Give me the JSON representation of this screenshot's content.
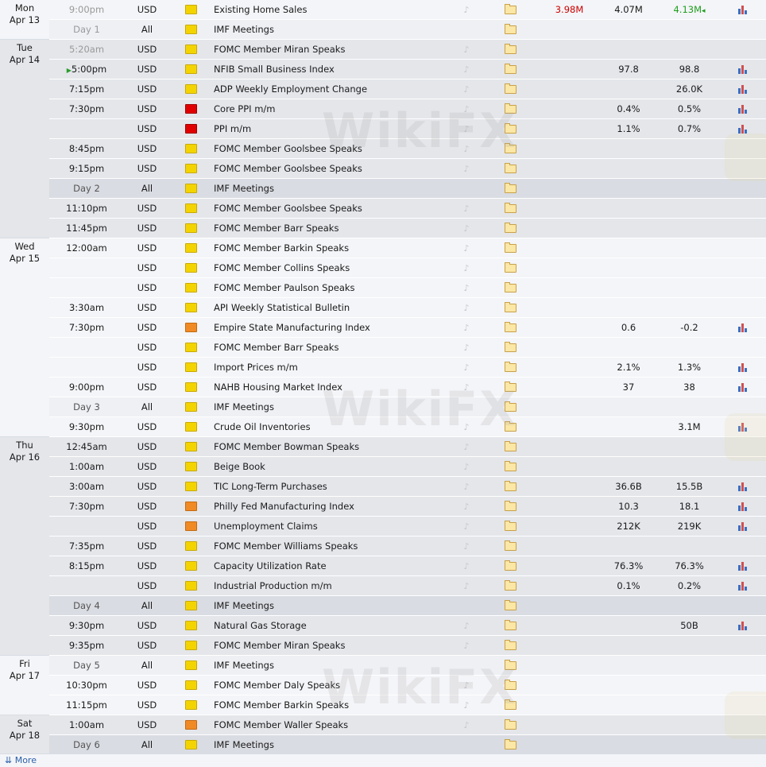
{
  "colors": {
    "actual_red": "#cc0000",
    "previous_green": "#1e9e1e",
    "low_impact": "#f3d400",
    "medium_impact": "#f08a24",
    "high_impact": "#e00000"
  },
  "watermark": "WikiFX",
  "more_link": "⇊ More",
  "days": [
    {
      "day": "Mon",
      "date": "Apr 13",
      "rows": [
        {
          "time": "9:00pm",
          "time_style": "past",
          "cur": "USD",
          "imp": "low",
          "event": "Existing Home Sales",
          "bell": true,
          "actual": "3.98M",
          "actual_color": "red",
          "forecast": "4.07M",
          "previous": "4.13M",
          "prev_color": "green",
          "prev_mark": "◂",
          "chart": true
        },
        {
          "time": "Day 1",
          "time_style": "past",
          "cur": "All",
          "imp": "low",
          "event": "IMF Meetings",
          "bell": false,
          "actual": "",
          "forecast": "",
          "previous": "",
          "chart": false,
          "sub": true
        }
      ]
    },
    {
      "day": "Tue",
      "date": "Apr 14",
      "rows": [
        {
          "time": "5:20am",
          "time_style": "past",
          "cur": "USD",
          "imp": "low",
          "event": "FOMC Member Miran Speaks",
          "bell": true,
          "actual": "",
          "forecast": "",
          "previous": "",
          "chart": false
        },
        {
          "time": "5:00pm",
          "time_style": "",
          "play": "▶",
          "cur": "USD",
          "imp": "low",
          "event": "NFIB Small Business Index",
          "bell": true,
          "actual": "",
          "forecast": "97.8",
          "previous": "98.8",
          "chart": true
        },
        {
          "time": "7:15pm",
          "time_style": "",
          "cur": "USD",
          "imp": "low",
          "event": "ADP Weekly Employment Change",
          "bell": true,
          "actual": "",
          "forecast": "",
          "previous": "26.0K",
          "chart": true
        },
        {
          "time": "7:30pm",
          "time_style": "",
          "cur": "USD",
          "imp": "high",
          "event": "Core PPI m/m",
          "bell": true,
          "actual": "",
          "forecast": "0.4%",
          "previous": "0.5%",
          "chart": true
        },
        {
          "time": "",
          "time_style": "",
          "cur": "USD",
          "imp": "high",
          "event": "PPI m/m",
          "bell": true,
          "actual": "",
          "forecast": "1.1%",
          "previous": "0.7%",
          "chart": true
        },
        {
          "time": "8:45pm",
          "time_style": "",
          "cur": "USD",
          "imp": "low",
          "event": "FOMC Member Goolsbee Speaks",
          "bell": true,
          "actual": "",
          "forecast": "",
          "previous": "",
          "chart": false
        },
        {
          "time": "9:15pm",
          "time_style": "",
          "cur": "USD",
          "imp": "low",
          "event": "FOMC Member Goolsbee Speaks",
          "bell": true,
          "actual": "",
          "forecast": "",
          "previous": "",
          "chart": false
        },
        {
          "time": "Day 2",
          "time_style": "sub",
          "cur": "All",
          "imp": "low",
          "event": "IMF Meetings",
          "bell": false,
          "actual": "",
          "forecast": "",
          "previous": "",
          "chart": false,
          "sub": true
        },
        {
          "time": "11:10pm",
          "time_style": "",
          "cur": "USD",
          "imp": "low",
          "event": "FOMC Member Goolsbee Speaks",
          "bell": true,
          "actual": "",
          "forecast": "",
          "previous": "",
          "chart": false
        },
        {
          "time": "11:45pm",
          "time_style": "",
          "cur": "USD",
          "imp": "low",
          "event": "FOMC Member Barr Speaks",
          "bell": true,
          "actual": "",
          "forecast": "",
          "previous": "",
          "chart": false
        }
      ]
    },
    {
      "day": "Wed",
      "date": "Apr 15",
      "rows": [
        {
          "time": "12:00am",
          "time_style": "",
          "cur": "USD",
          "imp": "low",
          "event": "FOMC Member Barkin Speaks",
          "bell": true,
          "actual": "",
          "forecast": "",
          "previous": "",
          "chart": false
        },
        {
          "time": "",
          "time_style": "",
          "cur": "USD",
          "imp": "low",
          "event": "FOMC Member Collins Speaks",
          "bell": true,
          "actual": "",
          "forecast": "",
          "previous": "",
          "chart": false
        },
        {
          "time": "",
          "time_style": "",
          "cur": "USD",
          "imp": "low",
          "event": "FOMC Member Paulson Speaks",
          "bell": true,
          "actual": "",
          "forecast": "",
          "previous": "",
          "chart": false
        },
        {
          "time": "3:30am",
          "time_style": "",
          "cur": "USD",
          "imp": "low",
          "event": "API Weekly Statistical Bulletin",
          "bell": true,
          "actual": "",
          "forecast": "",
          "previous": "",
          "chart": false
        },
        {
          "time": "7:30pm",
          "time_style": "",
          "cur": "USD",
          "imp": "med",
          "event": "Empire State Manufacturing Index",
          "bell": true,
          "actual": "",
          "forecast": "0.6",
          "previous": "-0.2",
          "chart": true
        },
        {
          "time": "",
          "time_style": "",
          "cur": "USD",
          "imp": "low",
          "event": "FOMC Member Barr Speaks",
          "bell": true,
          "actual": "",
          "forecast": "",
          "previous": "",
          "chart": false
        },
        {
          "time": "",
          "time_style": "",
          "cur": "USD",
          "imp": "low",
          "event": "Import Prices m/m",
          "bell": true,
          "actual": "",
          "forecast": "2.1%",
          "previous": "1.3%",
          "chart": true
        },
        {
          "time": "9:00pm",
          "time_style": "",
          "cur": "USD",
          "imp": "low",
          "event": "NAHB Housing Market Index",
          "bell": true,
          "actual": "",
          "forecast": "37",
          "previous": "38",
          "chart": true
        },
        {
          "time": "Day 3",
          "time_style": "sub",
          "cur": "All",
          "imp": "low",
          "event": "IMF Meetings",
          "bell": false,
          "actual": "",
          "forecast": "",
          "previous": "",
          "chart": false,
          "sub": true
        },
        {
          "time": "9:30pm",
          "time_style": "",
          "cur": "USD",
          "imp": "low",
          "event": "Crude Oil Inventories",
          "bell": true,
          "actual": "",
          "forecast": "",
          "previous": "3.1M",
          "chart": true
        }
      ]
    },
    {
      "day": "Thu",
      "date": "Apr 16",
      "rows": [
        {
          "time": "12:45am",
          "time_style": "",
          "cur": "USD",
          "imp": "low",
          "event": "FOMC Member Bowman Speaks",
          "bell": true,
          "actual": "",
          "forecast": "",
          "previous": "",
          "chart": false
        },
        {
          "time": "1:00am",
          "time_style": "",
          "cur": "USD",
          "imp": "low",
          "event": "Beige Book",
          "bell": true,
          "actual": "",
          "forecast": "",
          "previous": "",
          "chart": false
        },
        {
          "time": "3:00am",
          "time_style": "",
          "cur": "USD",
          "imp": "low",
          "event": "TIC Long-Term Purchases",
          "bell": true,
          "actual": "",
          "forecast": "36.6B",
          "previous": "15.5B",
          "chart": true
        },
        {
          "time": "7:30pm",
          "time_style": "",
          "cur": "USD",
          "imp": "med",
          "event": "Philly Fed Manufacturing Index",
          "bell": true,
          "actual": "",
          "forecast": "10.3",
          "previous": "18.1",
          "chart": true
        },
        {
          "time": "",
          "time_style": "",
          "cur": "USD",
          "imp": "med",
          "event": "Unemployment Claims",
          "bell": true,
          "actual": "",
          "forecast": "212K",
          "previous": "219K",
          "chart": true
        },
        {
          "time": "7:35pm",
          "time_style": "",
          "cur": "USD",
          "imp": "low",
          "event": "FOMC Member Williams Speaks",
          "bell": true,
          "actual": "",
          "forecast": "",
          "previous": "",
          "chart": false
        },
        {
          "time": "8:15pm",
          "time_style": "",
          "cur": "USD",
          "imp": "low",
          "event": "Capacity Utilization Rate",
          "bell": true,
          "actual": "",
          "forecast": "76.3%",
          "previous": "76.3%",
          "chart": true
        },
        {
          "time": "",
          "time_style": "",
          "cur": "USD",
          "imp": "low",
          "event": "Industrial Production m/m",
          "bell": true,
          "actual": "",
          "forecast": "0.1%",
          "previous": "0.2%",
          "chart": true
        },
        {
          "time": "Day 4",
          "time_style": "sub",
          "cur": "All",
          "imp": "low",
          "event": "IMF Meetings",
          "bell": false,
          "actual": "",
          "forecast": "",
          "previous": "",
          "chart": false,
          "sub": true
        },
        {
          "time": "9:30pm",
          "time_style": "",
          "cur": "USD",
          "imp": "low",
          "event": "Natural Gas Storage",
          "bell": true,
          "actual": "",
          "forecast": "",
          "previous": "50B",
          "chart": true
        },
        {
          "time": "9:35pm",
          "time_style": "",
          "cur": "USD",
          "imp": "low",
          "event": "FOMC Member Miran Speaks",
          "bell": true,
          "actual": "",
          "forecast": "",
          "previous": "",
          "chart": false
        }
      ]
    },
    {
      "day": "Fri",
      "date": "Apr 17",
      "rows": [
        {
          "time": "Day 5",
          "time_style": "sub",
          "cur": "All",
          "imp": "low",
          "event": "IMF Meetings",
          "bell": false,
          "actual": "",
          "forecast": "",
          "previous": "",
          "chart": false,
          "sub": true
        },
        {
          "time": "10:30pm",
          "time_style": "",
          "cur": "USD",
          "imp": "low",
          "event": "FOMC Member Daly Speaks",
          "bell": true,
          "actual": "",
          "forecast": "",
          "previous": "",
          "chart": false
        },
        {
          "time": "11:15pm",
          "time_style": "",
          "cur": "USD",
          "imp": "low",
          "event": "FOMC Member Barkin Speaks",
          "bell": true,
          "actual": "",
          "forecast": "",
          "previous": "",
          "chart": false
        }
      ]
    },
    {
      "day": "Sat",
      "date": "Apr 18",
      "rows": [
        {
          "time": "1:00am",
          "time_style": "",
          "cur": "USD",
          "imp": "med",
          "event": "FOMC Member Waller Speaks",
          "bell": true,
          "actual": "",
          "forecast": "",
          "previous": "",
          "chart": false
        },
        {
          "time": "Day 6",
          "time_style": "sub",
          "cur": "All",
          "imp": "low",
          "event": "IMF Meetings",
          "bell": false,
          "actual": "",
          "forecast": "",
          "previous": "",
          "chart": false,
          "sub": true
        }
      ]
    }
  ]
}
